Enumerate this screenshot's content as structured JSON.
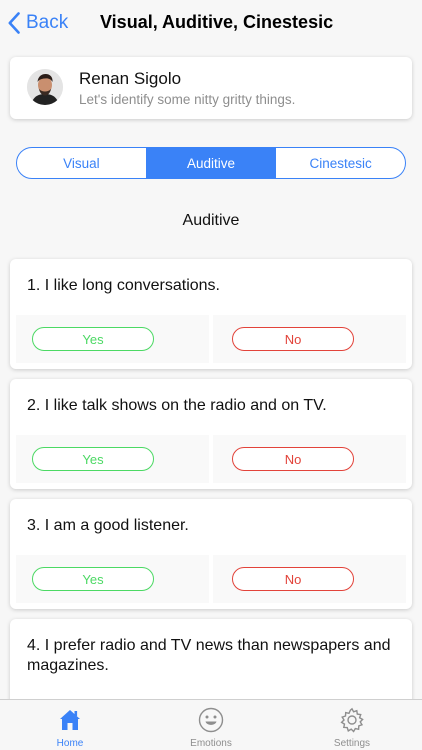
{
  "nav": {
    "back_label": "Back",
    "title": "Visual, Auditive, Cinestesic"
  },
  "profile": {
    "name": "Renan Sigolo",
    "subtitle": "Let's identify some nitty gritty things."
  },
  "segments": [
    {
      "label": "Visual",
      "active": false
    },
    {
      "label": "Auditive",
      "active": true
    },
    {
      "label": "Cinestesic",
      "active": false
    }
  ],
  "section_title": "Auditive",
  "answer_labels": {
    "yes": "Yes",
    "no": "No"
  },
  "questions": [
    {
      "text": "1. I like long conversations."
    },
    {
      "text": "2. I like talk shows on the radio and on TV."
    },
    {
      "text": "3. I am a good listener."
    },
    {
      "text": "4. I prefer radio and TV news than newspapers and magazines."
    }
  ],
  "tabs": [
    {
      "label": "Home",
      "icon": "home-icon",
      "active": true
    },
    {
      "label": "Emotions",
      "icon": "smiley-icon",
      "active": false
    },
    {
      "label": "Settings",
      "icon": "gear-icon",
      "active": false
    }
  ],
  "colors": {
    "accent": "#3a82f7",
    "yes": "#4cd964",
    "no": "#e2433a"
  }
}
